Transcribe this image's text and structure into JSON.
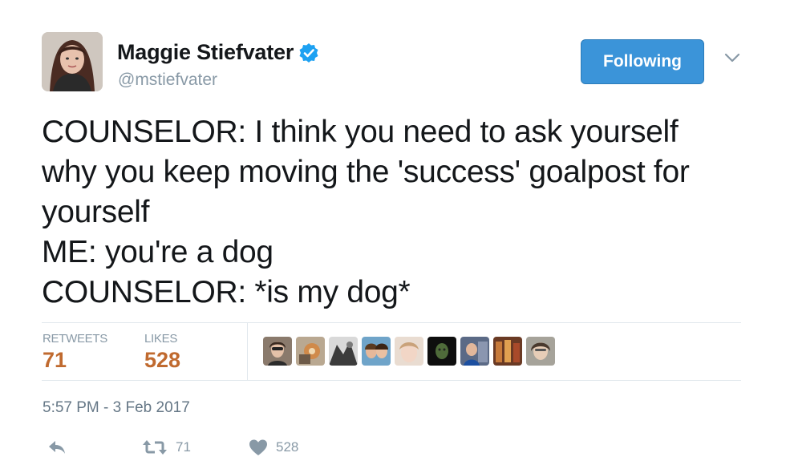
{
  "author": {
    "display_name": "Maggie Stiefvater",
    "handle": "@mstiefvater",
    "verified": true
  },
  "follow_button": {
    "label": "Following",
    "color": "#3b94d9"
  },
  "tweet": {
    "text": "COUNSELOR: I think you need to ask yourself\nwhy you keep moving the 'success' goalpost for\nyourself\nME: you're a dog\nCOUNSELOR: *is my dog*"
  },
  "stats": {
    "retweets_label": "RETWEETS",
    "retweets_value": "71",
    "likes_label": "LIKES",
    "likes_value": "528",
    "value_color": "#c06a2f"
  },
  "timestamp": "5:57 PM - 3 Feb 2017",
  "actions": {
    "reply_icon": "reply-icon",
    "retweet_icon": "retweet-icon",
    "retweet_count": "71",
    "like_icon": "heart-icon",
    "like_count": "528"
  },
  "likers": [
    {
      "name": "liker-avatar-1"
    },
    {
      "name": "liker-avatar-2"
    },
    {
      "name": "liker-avatar-3"
    },
    {
      "name": "liker-avatar-4"
    },
    {
      "name": "liker-avatar-5"
    },
    {
      "name": "liker-avatar-6"
    },
    {
      "name": "liker-avatar-7"
    },
    {
      "name": "liker-avatar-8"
    },
    {
      "name": "liker-avatar-9"
    }
  ]
}
